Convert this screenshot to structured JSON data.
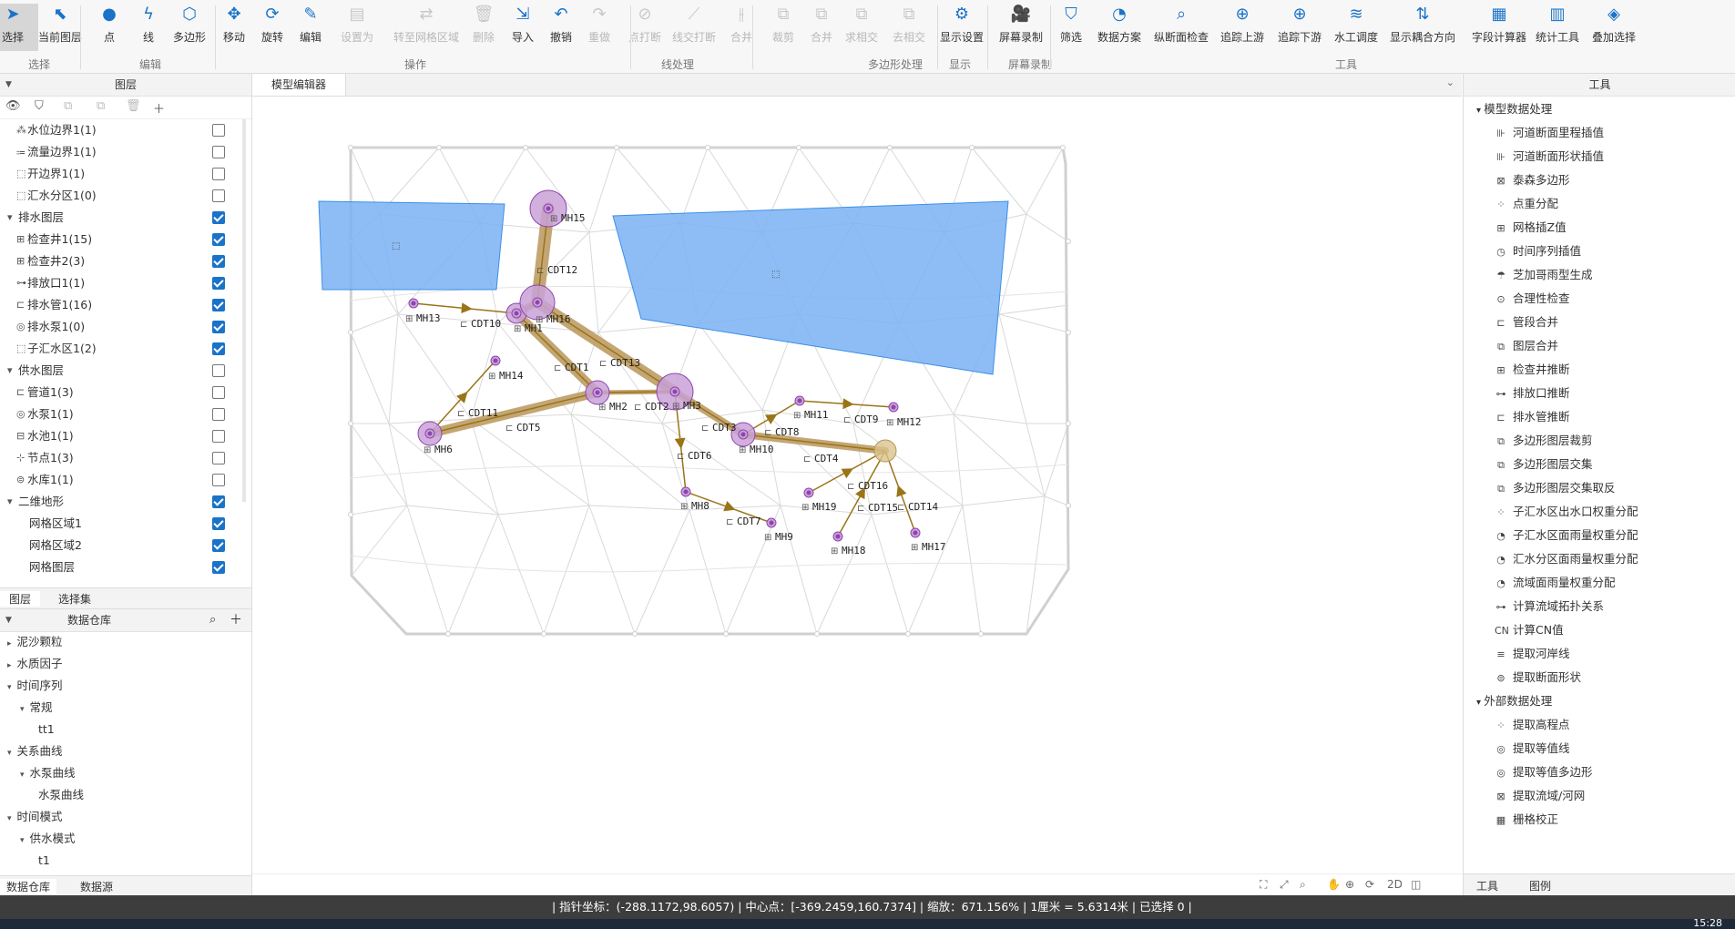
{
  "ribbon": {
    "buttons": [
      {
        "label": "选择",
        "icon": "cursor-icon",
        "glyph": "➤"
      },
      {
        "label": "当前图层",
        "icon": "layer-cursor-icon",
        "glyph": "⬉"
      },
      {
        "label": "点",
        "icon": "point-icon",
        "glyph": "●"
      },
      {
        "label": "线",
        "icon": "line-icon",
        "glyph": "ϟ"
      },
      {
        "label": "多边形",
        "icon": "polygon-icon",
        "glyph": "⬡"
      },
      {
        "label": "移动",
        "icon": "move-icon",
        "glyph": "✥"
      },
      {
        "label": "旋转",
        "icon": "rotate-icon",
        "glyph": "⟳"
      },
      {
        "label": "编辑",
        "icon": "pencil-icon",
        "glyph": "✎"
      },
      {
        "label": "设置为",
        "icon": "set-as-icon",
        "glyph": "▤"
      },
      {
        "label": "转至网格区域",
        "icon": "transfer-icon",
        "glyph": "⇄"
      },
      {
        "label": "删除",
        "icon": "delete-icon",
        "glyph": "🗑"
      },
      {
        "label": "导入",
        "icon": "import-icon",
        "glyph": "⇲"
      },
      {
        "label": "撤销",
        "icon": "undo-icon",
        "glyph": "↶"
      },
      {
        "label": "重做",
        "icon": "redo-icon",
        "glyph": "↷"
      },
      {
        "label": "点打断",
        "icon": "point-break-icon",
        "glyph": "⊘"
      },
      {
        "label": "线交打断",
        "icon": "line-intersect-break-icon",
        "glyph": "⟋"
      },
      {
        "label": "合并",
        "icon": "merge-line-icon",
        "glyph": "⫲"
      },
      {
        "label": "裁剪",
        "icon": "clip-icon",
        "glyph": "⧉"
      },
      {
        "label": "合并",
        "icon": "union-icon",
        "glyph": "⧉"
      },
      {
        "label": "求相交",
        "icon": "intersect-icon",
        "glyph": "⧉"
      },
      {
        "label": "去相交",
        "icon": "remove-intersect-icon",
        "glyph": "⧉"
      },
      {
        "label": "显示设置",
        "icon": "gear-icon",
        "glyph": "⚙"
      },
      {
        "label": "屏幕录制",
        "icon": "video-icon",
        "glyph": "🎥"
      },
      {
        "label": "筛选",
        "icon": "filter-icon",
        "glyph": "⛉"
      },
      {
        "label": "数据方案",
        "icon": "pie-icon",
        "glyph": "◔"
      },
      {
        "label": "纵断面检查",
        "icon": "profile-check-icon",
        "glyph": "⌕"
      },
      {
        "label": "追踪上游",
        "icon": "trace-upstream-icon",
        "glyph": "⊕"
      },
      {
        "label": "追踪下游",
        "icon": "trace-downstream-icon",
        "glyph": "⊕"
      },
      {
        "label": "水工调度",
        "icon": "hydraulic-icon",
        "glyph": "≋"
      },
      {
        "label": "显示耦合方向",
        "icon": "coupling-icon",
        "glyph": "⇅"
      },
      {
        "label": "字段计算器",
        "icon": "calculator-icon",
        "glyph": "▦"
      },
      {
        "label": "统计工具",
        "icon": "stats-icon",
        "glyph": "▥"
      },
      {
        "label": "叠加选择",
        "icon": "stack-icon",
        "glyph": "◈"
      }
    ],
    "groups": [
      "选择",
      "编辑",
      "操作",
      "线处理",
      "多边形处理",
      "显示",
      "屏幕录制",
      "工具"
    ]
  },
  "left": {
    "title": "图层",
    "layers": [
      {
        "label": "水位边界1(1)",
        "indent": 1,
        "checked": false,
        "icon": "boundary-icon",
        "glyph": "⁂"
      },
      {
        "label": "流量边界1(1)",
        "indent": 1,
        "checked": false,
        "icon": "flow-boundary-icon",
        "glyph": "⩴"
      },
      {
        "label": "开边界1(1)",
        "indent": 1,
        "checked": false,
        "icon": "open-boundary-icon",
        "glyph": "⬚"
      },
      {
        "label": "汇水分区1(0)",
        "indent": 1,
        "checked": false,
        "icon": "catchment-icon",
        "glyph": "⬚"
      },
      {
        "label": "排水图层",
        "indent": 0,
        "checked": true,
        "icon": "expand-icon",
        "glyph": "▾"
      },
      {
        "label": "检查井1(15)",
        "indent": 1,
        "checked": true,
        "icon": "manhole-icon",
        "glyph": "⊞"
      },
      {
        "label": "检查井2(3)",
        "indent": 1,
        "checked": true,
        "icon": "manhole-icon",
        "glyph": "⊞"
      },
      {
        "label": "排放口1(1)",
        "indent": 1,
        "checked": true,
        "icon": "outfall-icon",
        "glyph": "⊶"
      },
      {
        "label": "排水管1(16)",
        "indent": 1,
        "checked": true,
        "icon": "pipe-icon",
        "glyph": "⊏"
      },
      {
        "label": "排水泵1(0)",
        "indent": 1,
        "checked": true,
        "icon": "pump-icon",
        "glyph": "◎"
      },
      {
        "label": "子汇水区1(2)",
        "indent": 1,
        "checked": true,
        "icon": "subcatchment-icon",
        "glyph": "⬚"
      },
      {
        "label": "供水图层",
        "indent": 0,
        "checked": false,
        "icon": "expand-icon",
        "glyph": "▾"
      },
      {
        "label": "管道1(3)",
        "indent": 1,
        "checked": false,
        "icon": "pipe-icon",
        "glyph": "⊏"
      },
      {
        "label": "水泵1(1)",
        "indent": 1,
        "checked": false,
        "icon": "pump-icon",
        "glyph": "◎"
      },
      {
        "label": "水池1(1)",
        "indent": 1,
        "checked": false,
        "icon": "tank-icon",
        "glyph": "⊟"
      },
      {
        "label": "节点1(3)",
        "indent": 1,
        "checked": false,
        "icon": "node-icon",
        "glyph": "⊹"
      },
      {
        "label": "水库1(1)",
        "indent": 1,
        "checked": false,
        "icon": "reservoir-icon",
        "glyph": "⊜"
      },
      {
        "label": "二维地形",
        "indent": 0,
        "checked": true,
        "icon": "expand-icon",
        "glyph": "▾"
      },
      {
        "label": "网格区域1",
        "indent": 2,
        "checked": true,
        "icon": "",
        "glyph": ""
      },
      {
        "label": "网格区域2",
        "indent": 2,
        "checked": true,
        "icon": "",
        "glyph": ""
      },
      {
        "label": "网格图层",
        "indent": 2,
        "checked": true,
        "icon": "",
        "glyph": ""
      }
    ],
    "tabs": [
      "图层",
      "选择集"
    ],
    "warehouse_title": "数据仓库",
    "tree": [
      {
        "label": "泥沙颗粒",
        "level": 0,
        "arrow": "▸"
      },
      {
        "label": "水质因子",
        "level": 0,
        "arrow": "▸"
      },
      {
        "label": "时间序列",
        "level": 0,
        "arrow": "▾"
      },
      {
        "label": "常规",
        "level": 1,
        "arrow": "▾"
      },
      {
        "label": "tt1",
        "level": 2,
        "arrow": ""
      },
      {
        "label": "关系曲线",
        "level": 0,
        "arrow": "▾"
      },
      {
        "label": "水泵曲线",
        "level": 1,
        "arrow": "▾"
      },
      {
        "label": "水泵曲线",
        "level": 2,
        "arrow": ""
      },
      {
        "label": "时间模式",
        "level": 0,
        "arrow": "▾"
      },
      {
        "label": "供水模式",
        "level": 1,
        "arrow": "▾"
      },
      {
        "label": "t1",
        "level": 2,
        "arrow": ""
      }
    ],
    "bottom_tabs": [
      "数据仓库",
      "数据源"
    ]
  },
  "center": {
    "tab": "模型编辑器",
    "map_labels": {
      "MH15": "MH15",
      "CDT12": "CDT12",
      "MH13": "MH13",
      "CDT10": "CDT10",
      "MH1": "MH1",
      "MH16": "MH16",
      "CDT13": "CDT13",
      "CDT1": "CDT1",
      "MH14": "MH14",
      "CDT11": "CDT11",
      "MH2": "MH2",
      "CDT2": "CDT2",
      "MH3": "MH3",
      "CDT5": "CDT5",
      "MH6": "MH6",
      "CDT3": "CDT3",
      "CDT8": "CDT8",
      "MH11": "MH11",
      "CDT9": "CDT9",
      "MH12": "MH12",
      "MH10": "MH10",
      "CDT4": "CDT4",
      "CDT6": "CDT6",
      "CDT16": "CDT16",
      "MH19": "MH19",
      "CDT15": "CDT15",
      "CDT14": "CDT14",
      "MH8": "MH8",
      "CDT7": "CDT7",
      "MH9": "MH9",
      "MH18": "MH18",
      "MH17": "MH17"
    },
    "map_tools": [
      "⛶",
      "⤢",
      "⌕",
      "✋",
      "⊕",
      "⟳",
      "2D",
      "◫"
    ]
  },
  "right": {
    "title": "工具",
    "sections": [
      {
        "title": "模型数据处理",
        "items": [
          {
            "label": "河道断面里程插值",
            "glyph": "⊪"
          },
          {
            "label": "河道断面形状插值",
            "glyph": "⊪"
          },
          {
            "label": "泰森多边形",
            "glyph": "⊠"
          },
          {
            "label": "点重分配",
            "glyph": "⁘"
          },
          {
            "label": "网格插Z值",
            "glyph": "⊞"
          },
          {
            "label": "时间序列插值",
            "glyph": "◷"
          },
          {
            "label": "芝加哥雨型生成",
            "glyph": "☂"
          },
          {
            "label": "合理性检查",
            "glyph": "⊙"
          },
          {
            "label": "管段合并",
            "glyph": "⊏"
          },
          {
            "label": "图层合并",
            "glyph": "⧉"
          },
          {
            "label": "检查井推断",
            "glyph": "⊞"
          },
          {
            "label": "排放口推断",
            "glyph": "⊶"
          },
          {
            "label": "排水管推断",
            "glyph": "⊏"
          },
          {
            "label": "多边形图层裁剪",
            "glyph": "⧉"
          },
          {
            "label": "多边形图层交集",
            "glyph": "⧉"
          },
          {
            "label": "多边形图层交集取反",
            "glyph": "⧉"
          },
          {
            "label": "子汇水区出水口权重分配",
            "glyph": "⁘"
          },
          {
            "label": "子汇水区面雨量权重分配",
            "glyph": "◔"
          },
          {
            "label": "汇水分区面雨量权重分配",
            "glyph": "◔"
          },
          {
            "label": "流域面雨量权重分配",
            "glyph": "◔"
          },
          {
            "label": "计算流域拓扑关系",
            "glyph": "⊶"
          },
          {
            "label": "计算CN值",
            "glyph": "CN"
          },
          {
            "label": "提取河岸线",
            "glyph": "≡"
          },
          {
            "label": "提取断面形状",
            "glyph": "⊜"
          }
        ]
      },
      {
        "title": "外部数据处理",
        "items": [
          {
            "label": "提取高程点",
            "glyph": "⁘"
          },
          {
            "label": "提取等值线",
            "glyph": "◎"
          },
          {
            "label": "提取等值多边形",
            "glyph": "◎"
          },
          {
            "label": "提取流域/河网",
            "glyph": "⊠"
          },
          {
            "label": "栅格校正",
            "glyph": "▦"
          }
        ]
      }
    ],
    "tabs": [
      "工具",
      "图例"
    ]
  },
  "status": {
    "text": "|  指针坐标：(-288.1172,98.6057)   |  中心点：[-369.2459,160.7374]   |  缩放：671.156%   |  1厘米 = 5.6314米   |  已选择 0   |"
  },
  "taskbar": {
    "clock": "15:28"
  },
  "colors": {
    "accent": "#1a73c8",
    "pipe": "#b8975a",
    "pipe_dark": "#9a7418",
    "node": "#8e44ad",
    "node_fill": "#c9a2d8",
    "polygon_fill": "#7ab2f3",
    "polygon_stroke": "#3b8fe8",
    "mesh": "#d9d9d9",
    "status_bg": "#3d3d3d"
  }
}
